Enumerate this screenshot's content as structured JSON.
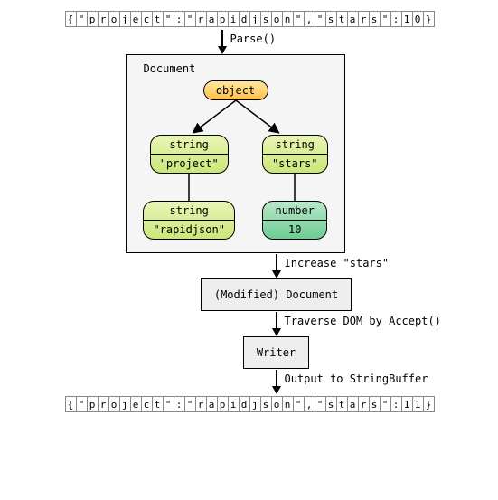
{
  "input_json": "{\"project\":\"rapidjson\",\"stars\":10}",
  "output_json": "{\"project\":\"rapidjson\",\"stars\":11}",
  "steps": {
    "parse": "Parse()",
    "increase": "Increase \"stars\"",
    "traverse": "Traverse DOM by Accept()",
    "output": "Output to StringBuffer"
  },
  "boxes": {
    "document": "Document",
    "modified": "(Modified) Document",
    "writer": "Writer"
  },
  "tree": {
    "root_type": "object",
    "key1_type": "string",
    "key1_value": "\"project\"",
    "val1_type": "string",
    "val1_value": "\"rapidjson\"",
    "key2_type": "string",
    "key2_value": "\"stars\"",
    "val2_type": "number",
    "val2_value": "10"
  }
}
